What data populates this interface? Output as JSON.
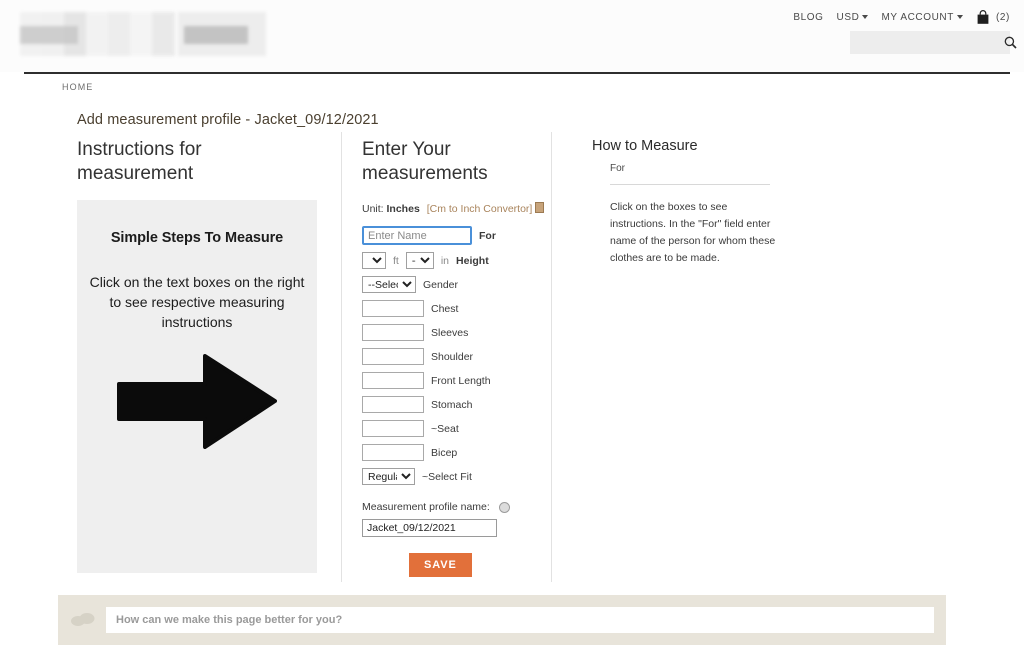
{
  "header": {
    "nav": [
      {
        "label": "BLOG",
        "caret": false
      },
      {
        "label": "USD",
        "caret": true
      },
      {
        "label": "MY ACCOUNT",
        "caret": true
      }
    ],
    "cart_icon": "shopping-bag-icon",
    "cart_count": "(2)",
    "search": {
      "value": "",
      "placeholder": "",
      "icon": "search-icon"
    }
  },
  "breadcrumb": {
    "home": "HOME"
  },
  "page": {
    "title": "Add measurement profile - Jacket_09/12/2021"
  },
  "left": {
    "heading": "Instructions for measurement",
    "panel_title": "Simple Steps To Measure",
    "panel_body": "Click on the text boxes on the right to see respective measuring instructions",
    "arrow_icon": "arrow-right-icon"
  },
  "middle": {
    "heading": "Enter Your measurements",
    "unit_prefix": "Unit:",
    "unit_value": "Inches",
    "convertor_link": "[Cm to Inch Convertor]",
    "convertor_icon": "calculator-icon",
    "name_field": {
      "value": "",
      "placeholder": "Enter Name",
      "label": "For"
    },
    "height": {
      "ft_value": "-",
      "ft_suffix": "ft",
      "in_value": "--",
      "in_suffix": "in",
      "label": "Height"
    },
    "gender": {
      "value": "--Select--",
      "label": "Gender"
    },
    "measurements": [
      {
        "label": "Chest",
        "value": ""
      },
      {
        "label": "Sleeves",
        "value": ""
      },
      {
        "label": "Shoulder",
        "value": ""
      },
      {
        "label": "Front Length",
        "value": ""
      },
      {
        "label": "Stomach",
        "value": ""
      },
      {
        "label": "~Seat",
        "value": ""
      },
      {
        "label": "Bicep",
        "value": ""
      }
    ],
    "fit": {
      "value": "Regular",
      "label": "~Select Fit"
    },
    "profile_name": {
      "label": "Measurement profile name:",
      "help_icon": "help-icon",
      "value": "Jacket_09/12/2021"
    },
    "save_label": "SAVE"
  },
  "right": {
    "heading": "How to Measure",
    "for_label": "For",
    "body": "Click on the boxes to see instructions.\nIn the \"For\" field enter name of the person for whom these clothes are to be made."
  },
  "feedback": {
    "icon": "speech-bubbles-icon",
    "placeholder": "How can we make this page better for you?",
    "value": ""
  },
  "colors": {
    "accent_orange": "#e2703a",
    "link_brown": "#a9845c",
    "panel_grey": "#efefef",
    "feedback_beige": "#e8e4da",
    "focus_blue": "#4a90d9"
  }
}
